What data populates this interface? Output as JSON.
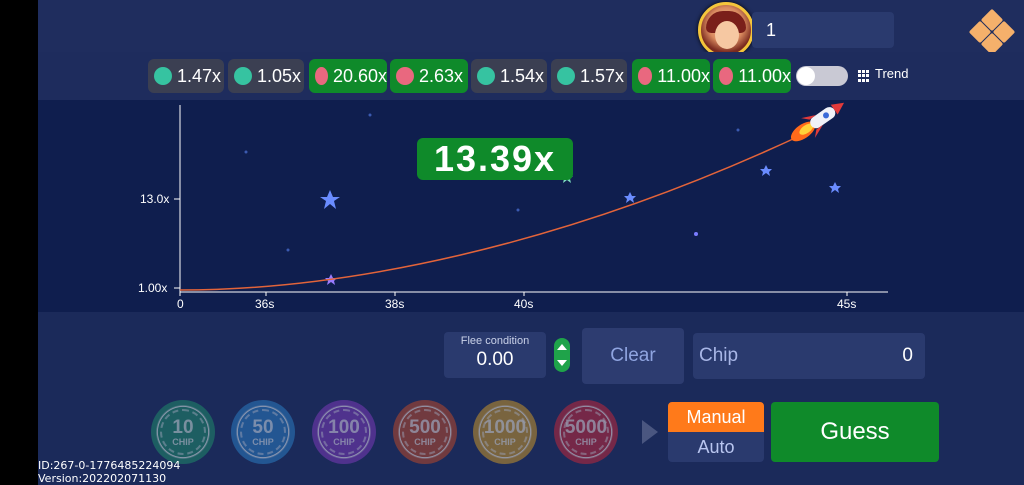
{
  "player": {
    "count": "1"
  },
  "history": {
    "items": [
      {
        "value": "1.47x",
        "dot": "teal",
        "bg": "gray"
      },
      {
        "value": "1.05x",
        "dot": "teal",
        "bg": "gray"
      },
      {
        "value": "20.60x",
        "dot": "pink",
        "bg": "green"
      },
      {
        "value": "2.63x",
        "dot": "pink",
        "bg": "green"
      },
      {
        "value": "1.54x",
        "dot": "teal",
        "bg": "gray"
      },
      {
        "value": "1.57x",
        "dot": "teal",
        "bg": "gray"
      },
      {
        "value": "11.00x",
        "dot": "pink",
        "bg": "green"
      },
      {
        "value": "11.00x",
        "dot": "pink",
        "bg": "green"
      }
    ],
    "trend_label": "Trend"
  },
  "game": {
    "current_multiplier": "13.39x",
    "y_ticks": [
      "13.0x",
      "1.00x"
    ],
    "x_ticks": [
      "0",
      "36s",
      "38s",
      "40s",
      "45s"
    ]
  },
  "controls": {
    "flee_label": "Flee condition",
    "flee_value": "0.00",
    "clear_label": "Clear",
    "chip_label": "Chip",
    "chip_value": "0",
    "mode_manual": "Manual",
    "mode_auto": "Auto",
    "guess_label": "Guess"
  },
  "chips": [
    {
      "num": "10",
      "sub": "CHIP",
      "color": "#1f8a6a"
    },
    {
      "num": "50",
      "sub": "CHIP",
      "color": "#2a7bc0"
    },
    {
      "num": "100",
      "sub": "CHIP",
      "color": "#7a3ab8"
    },
    {
      "num": "500",
      "sub": "CHIP",
      "color": "#b8482a"
    },
    {
      "num": "1000",
      "sub": "CHIP",
      "color": "#c7952a"
    },
    {
      "num": "5000",
      "sub": "CHIP",
      "color": "#c0283a"
    }
  ],
  "build": {
    "id": "ID:267-0-1776485224094",
    "version": "Version:202202071130"
  },
  "colors": {
    "accent_green": "#0f8a2a",
    "accent_orange": "#ff7a1a",
    "background": "#1b2a5a",
    "chart_bg": "#0f1e4e",
    "curve": "#e3643a"
  }
}
